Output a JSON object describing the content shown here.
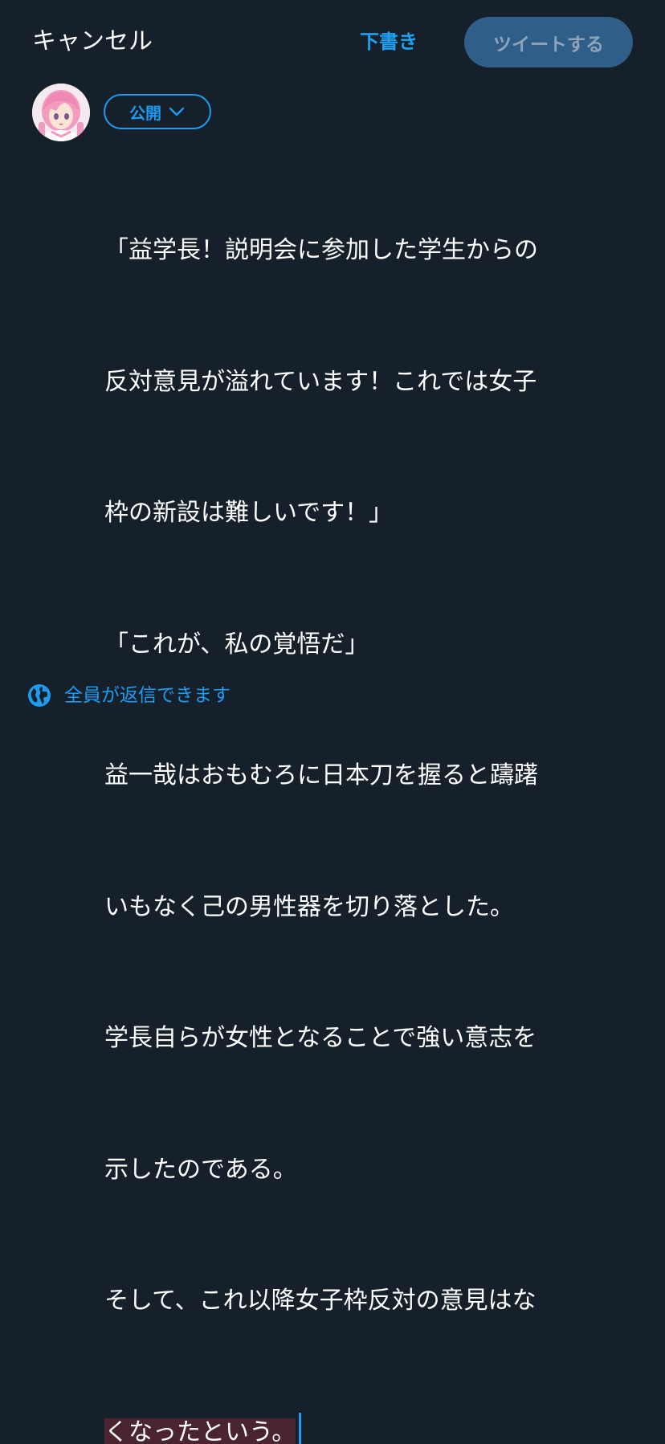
{
  "header": {
    "cancel_label": "キャンセル",
    "draft_label": "下書き",
    "tweet_label": "ツイートする"
  },
  "audience": {
    "label": "公開",
    "icon": "chevron-down-icon"
  },
  "compose": {
    "lines": [
      "「益学長！説明会に参加した学生からの",
      "反対意見が溢れています！これでは女子",
      "枠の新設は難しいです！」",
      "「これが、私の覚悟だ」",
      "益一哉はおもむろに日本刀を握ると躊躇",
      "いもなく己の男性器を切り落とした。",
      "学長自らが女性となることで強い意志を",
      "示したのである。",
      "そして、これ以降女子枠反対の意見はな"
    ],
    "highlighted_line": "くなったという。"
  },
  "reply_setting": {
    "label": "全員が返信できます",
    "icon": "globe-icon"
  },
  "colors": {
    "background": "#15202b",
    "accent": "#1d9bf0",
    "tweet_button": "#2f5f89",
    "highlight": "#4a2430"
  }
}
